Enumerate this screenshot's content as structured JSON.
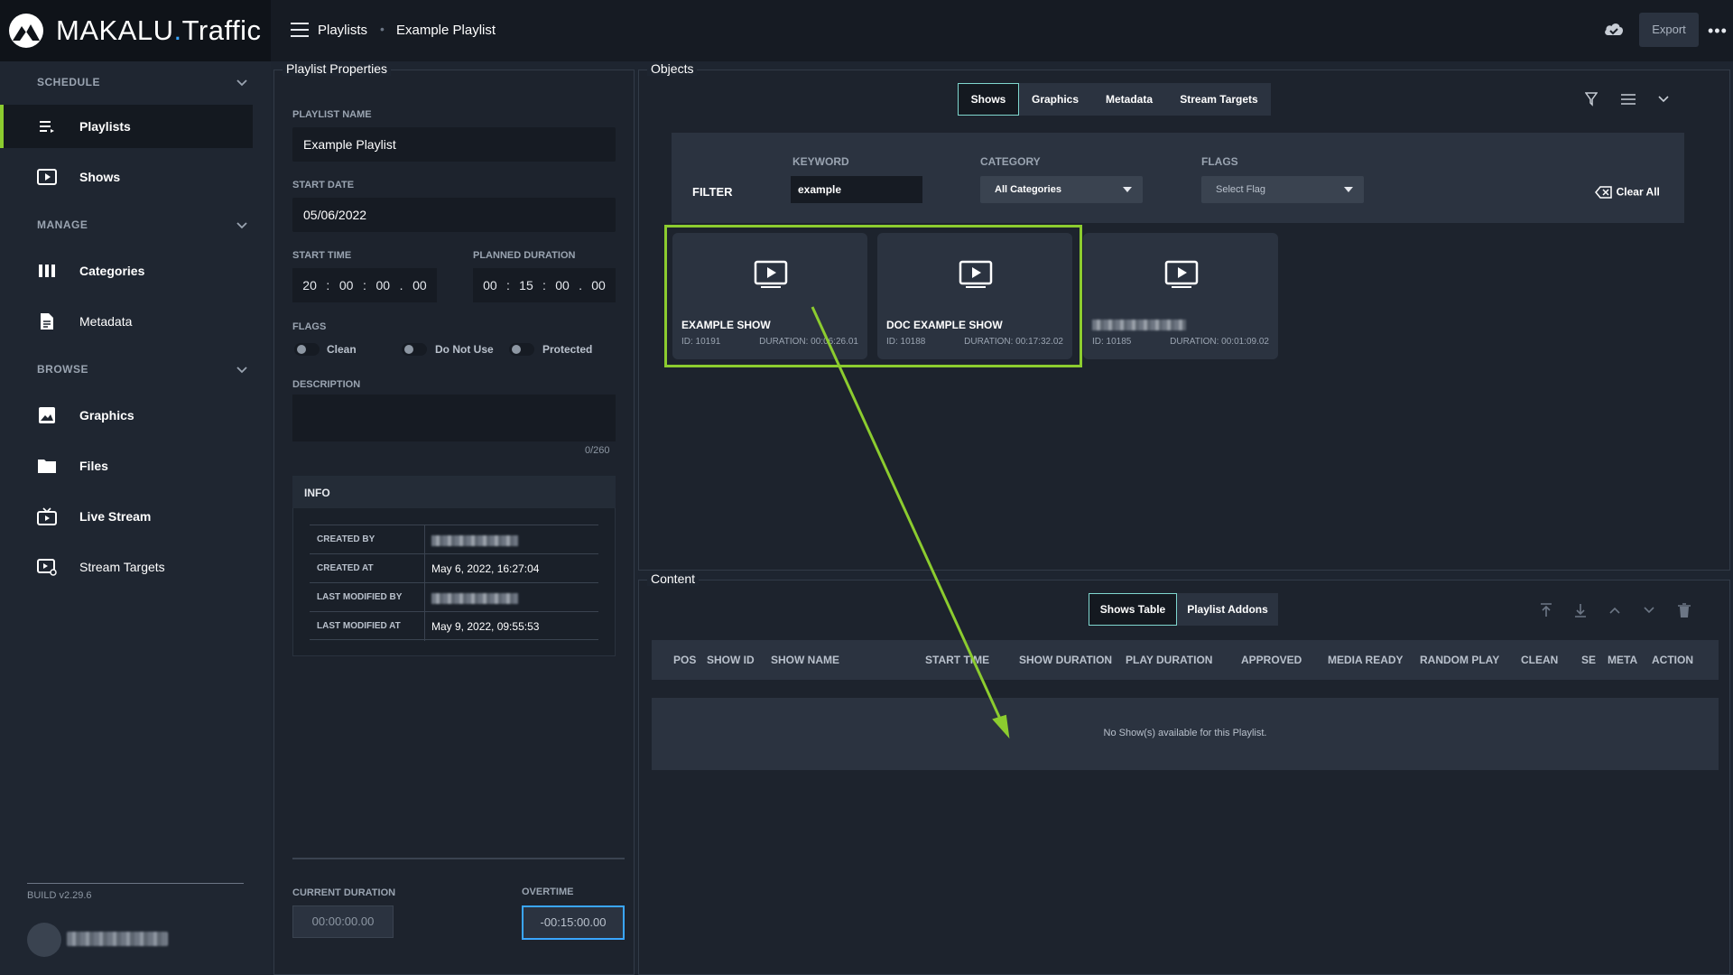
{
  "app": {
    "brand_main": "MAKALU",
    "brand_dot": ".",
    "brand_sub": "Traffic"
  },
  "header": {
    "breadcrumb": [
      "Playlists",
      "Example Playlist"
    ],
    "breadcrumb_sep": "•",
    "export_label": "Export",
    "more_icon": "more-horizontal-icon",
    "cloud_icon": "cloud-icon"
  },
  "sidebar": {
    "sections": [
      {
        "label": "SCHEDULE"
      },
      {
        "label": "MANAGE"
      },
      {
        "label": "BROWSE"
      }
    ],
    "items": [
      {
        "label": "Playlists",
        "icon": "playlist-icon",
        "active": true
      },
      {
        "label": "Shows",
        "icon": "play-icon"
      },
      {
        "label": "Categories",
        "icon": "columns-icon"
      },
      {
        "label": "Metadata",
        "icon": "document-icon"
      },
      {
        "label": "Graphics",
        "icon": "image-icon"
      },
      {
        "label": "Files",
        "icon": "folder-icon"
      },
      {
        "label": "Live Stream",
        "icon": "live-tv-icon"
      },
      {
        "label": "Stream Targets",
        "icon": "stream-target-icon"
      }
    ],
    "build": "BUILD v2.29.6",
    "accent_color": "#8ccc2f"
  },
  "props": {
    "title": "Playlist Properties",
    "name_label": "PLAYLIST NAME",
    "name_value": "Example Playlist",
    "start_date_label": "START DATE",
    "start_date_value": "05/06/2022",
    "start_time_label": "START TIME",
    "start_time": [
      "20",
      "00",
      "00",
      "00"
    ],
    "planned_duration_label": "PLANNED DURATION",
    "planned_duration": [
      "00",
      "15",
      "00",
      "00"
    ],
    "flags_label": "FLAGS",
    "flags": [
      "Clean",
      "Do Not Use",
      "Protected"
    ],
    "description_label": "DESCRIPTION",
    "description_count": "0/260",
    "info_title": "INFO",
    "info_rows": [
      {
        "key": "CREATED BY",
        "value": ""
      },
      {
        "key": "CREATED AT",
        "value": "May 6, 2022, 16:27:04"
      },
      {
        "key": "LAST MODIFIED BY",
        "value": ""
      },
      {
        "key": "LAST MODIFIED AT",
        "value": "May 9, 2022, 09:55:53"
      }
    ],
    "current_duration_label": "CURRENT DURATION",
    "current_duration_value": "00:00:00.00",
    "overtime_label": "OVERTIME",
    "overtime_value": "-00:15:00.00"
  },
  "objects": {
    "title": "Objects",
    "tabs": [
      "Shows",
      "Graphics",
      "Metadata",
      "Stream Targets"
    ],
    "active_tab": "Shows",
    "filter_label": "FILTER",
    "keyword_label": "KEYWORD",
    "keyword_value": "example",
    "category_label": "CATEGORY",
    "category_value": "All Categories",
    "flags_label": "FLAGS",
    "flags_placeholder": "Select Flag",
    "clear_all": "Clear All",
    "cards": [
      {
        "name": "EXAMPLE SHOW",
        "id": "ID: 10191",
        "duration": "DURATION: 00:06:26.01"
      },
      {
        "name": "DOC EXAMPLE SHOW",
        "id": "ID: 10188",
        "duration": "DURATION: 00:17:32.02"
      },
      {
        "name": "",
        "id": "ID: 10185",
        "duration": "DURATION: 00:01:09.02"
      }
    ],
    "highlight_color": "#8ccc2f"
  },
  "content": {
    "title": "Content",
    "tabs": [
      "Shows Table",
      "Playlist Addons"
    ],
    "active_tab": "Shows Table",
    "columns": [
      "POS",
      "SHOW ID",
      "SHOW NAME",
      "START TIME",
      "SHOW DURATION",
      "PLAY DURATION",
      "APPROVED",
      "MEDIA READY",
      "RANDOM PLAY",
      "CLEAN",
      "SE",
      "META",
      "ACTION"
    ],
    "empty_message": "No Show(s) available for this Playlist."
  }
}
